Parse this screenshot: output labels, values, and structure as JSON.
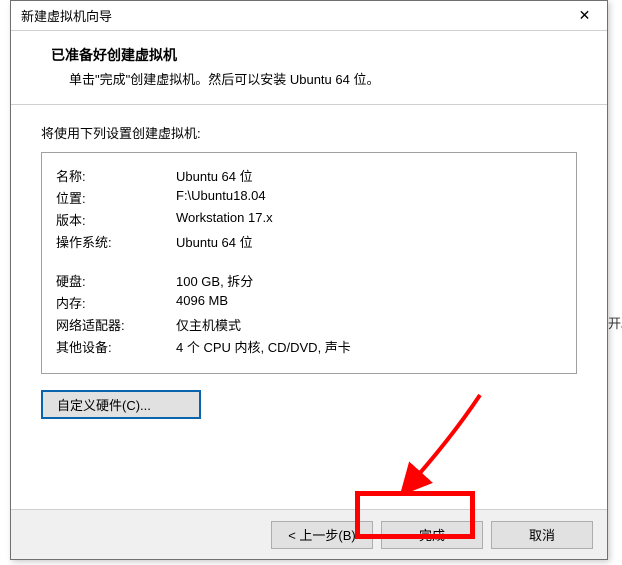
{
  "dialog": {
    "title": "新建虚拟机向导",
    "close": "✕"
  },
  "header": {
    "title": "已准备好创建虚拟机",
    "subtitle": "单击\"完成\"创建虚拟机。然后可以安装 Ubuntu 64 位。"
  },
  "section_intro": "将使用下列设置创建虚拟机:",
  "settings": {
    "name_label": "名称:",
    "name_value": "Ubuntu 64 位",
    "location_label": "位置:",
    "location_value": "F:\\Ubuntu18.04",
    "version_label": "版本:",
    "version_value": "Workstation 17.x",
    "os_label": "操作系统:",
    "os_value": "Ubuntu 64 位",
    "disk_label": "硬盘:",
    "disk_value": "100 GB, 拆分",
    "memory_label": "内存:",
    "memory_value": "4096 MB",
    "network_label": "网络适配器:",
    "network_value": "仅主机模式",
    "other_label": "其他设备:",
    "other_value": "4 个 CPU 内核, CD/DVD, 声卡"
  },
  "buttons": {
    "customize": "自定义硬件(C)...",
    "back": "< 上一步(B)",
    "finish": "完成",
    "cancel": "取消"
  },
  "side_text": "开。"
}
